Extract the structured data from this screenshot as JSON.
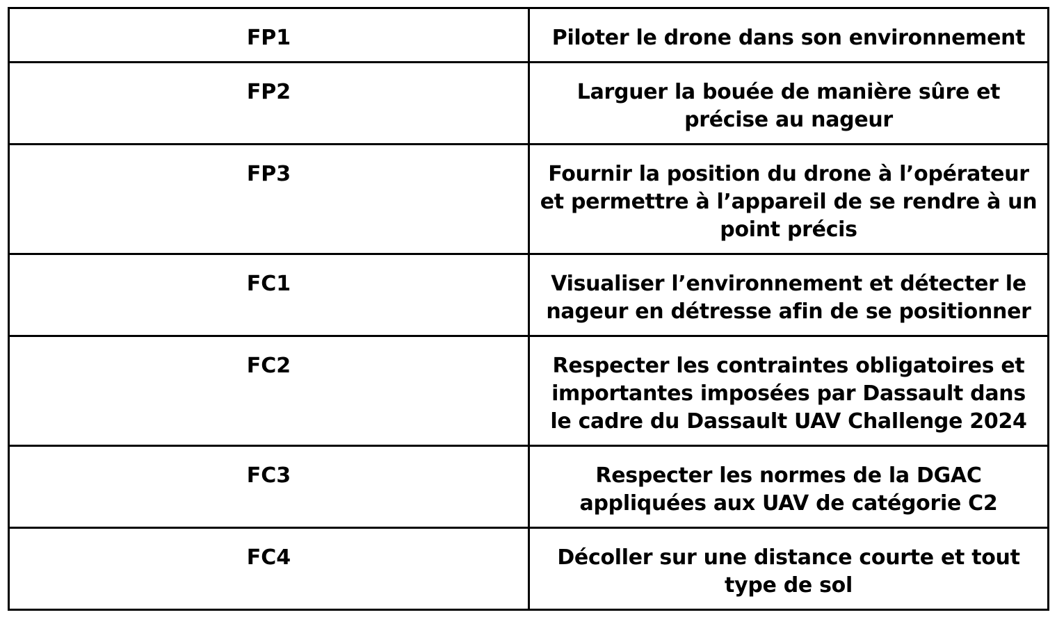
{
  "table": {
    "rows": [
      {
        "code": "FP1",
        "lines": [
          "Piloter le drone dans son environnement"
        ]
      },
      {
        "code": "FP2",
        "lines": [
          "Larguer la bouée de manière sûre et",
          "précise au nageur"
        ]
      },
      {
        "code": "FP3",
        "lines": [
          "Fournir la position du drone à l’opérateur",
          "et permettre à l’appareil de se rendre à un",
          "point précis"
        ]
      },
      {
        "code": "FC1",
        "lines": [
          "Visualiser l’environnement et détecter le",
          "nageur en détresse afin de se positionner"
        ]
      },
      {
        "code": "FC2",
        "lines": [
          "Respecter les contraintes obligatoires et",
          "importantes imposées par Dassault dans",
          "le cadre du Dassault UAV Challenge 2024"
        ]
      },
      {
        "code": "FC3",
        "lines": [
          "Respecter les normes de la DGAC",
          "appliquées aux UAV de catégorie C2"
        ]
      },
      {
        "code": "FC4",
        "lines": [
          "Décoller sur une distance courte et tout",
          "type de sol"
        ]
      }
    ]
  }
}
